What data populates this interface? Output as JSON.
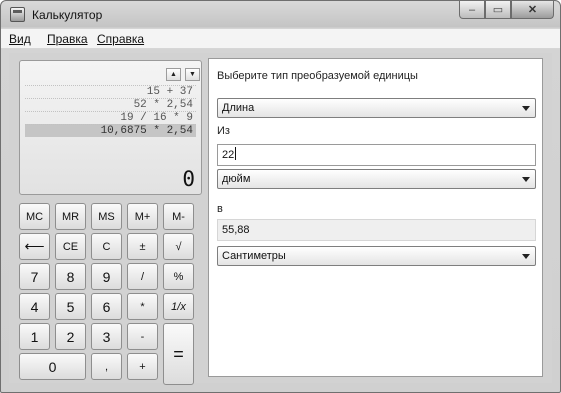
{
  "window": {
    "title": "Калькулятор",
    "controls": {
      "minimize": "–",
      "maximize": "▭",
      "close": "✕"
    }
  },
  "menu": [
    "Вид",
    "Правка",
    "Справка"
  ],
  "calculator": {
    "history_up": "▲",
    "history_down": "▼",
    "history": [
      "15 + 37",
      "52 * 2,54",
      "19 / 16 * 9",
      "10,6875 * 2,54"
    ],
    "selected_history_index": 3,
    "result": "0",
    "keys": {
      "mc": "MC",
      "mr": "MR",
      "ms": "MS",
      "mplus": "M+",
      "mminus": "M-",
      "backspace": "⟵",
      "ce": "CE",
      "c": "C",
      "plusminus": "±",
      "sqrt": "√",
      "d7": "7",
      "d8": "8",
      "d9": "9",
      "divide": "/",
      "percent": "%",
      "d4": "4",
      "d5": "5",
      "d6": "6",
      "multiply": "*",
      "reciprocal": "1/x",
      "d1": "1",
      "d2": "2",
      "d3": "3",
      "minus": "-",
      "equals": "=",
      "d0": "0",
      "decimal": ",",
      "plus": "+"
    }
  },
  "converter": {
    "type_label": "Выберите тип преобразуемой единицы",
    "type_value": "Длина",
    "from_label": "Из",
    "from_value": "22",
    "from_unit": "дюйм",
    "to_label": "в",
    "to_value": "55,88",
    "to_unit": "Сантиметры"
  }
}
